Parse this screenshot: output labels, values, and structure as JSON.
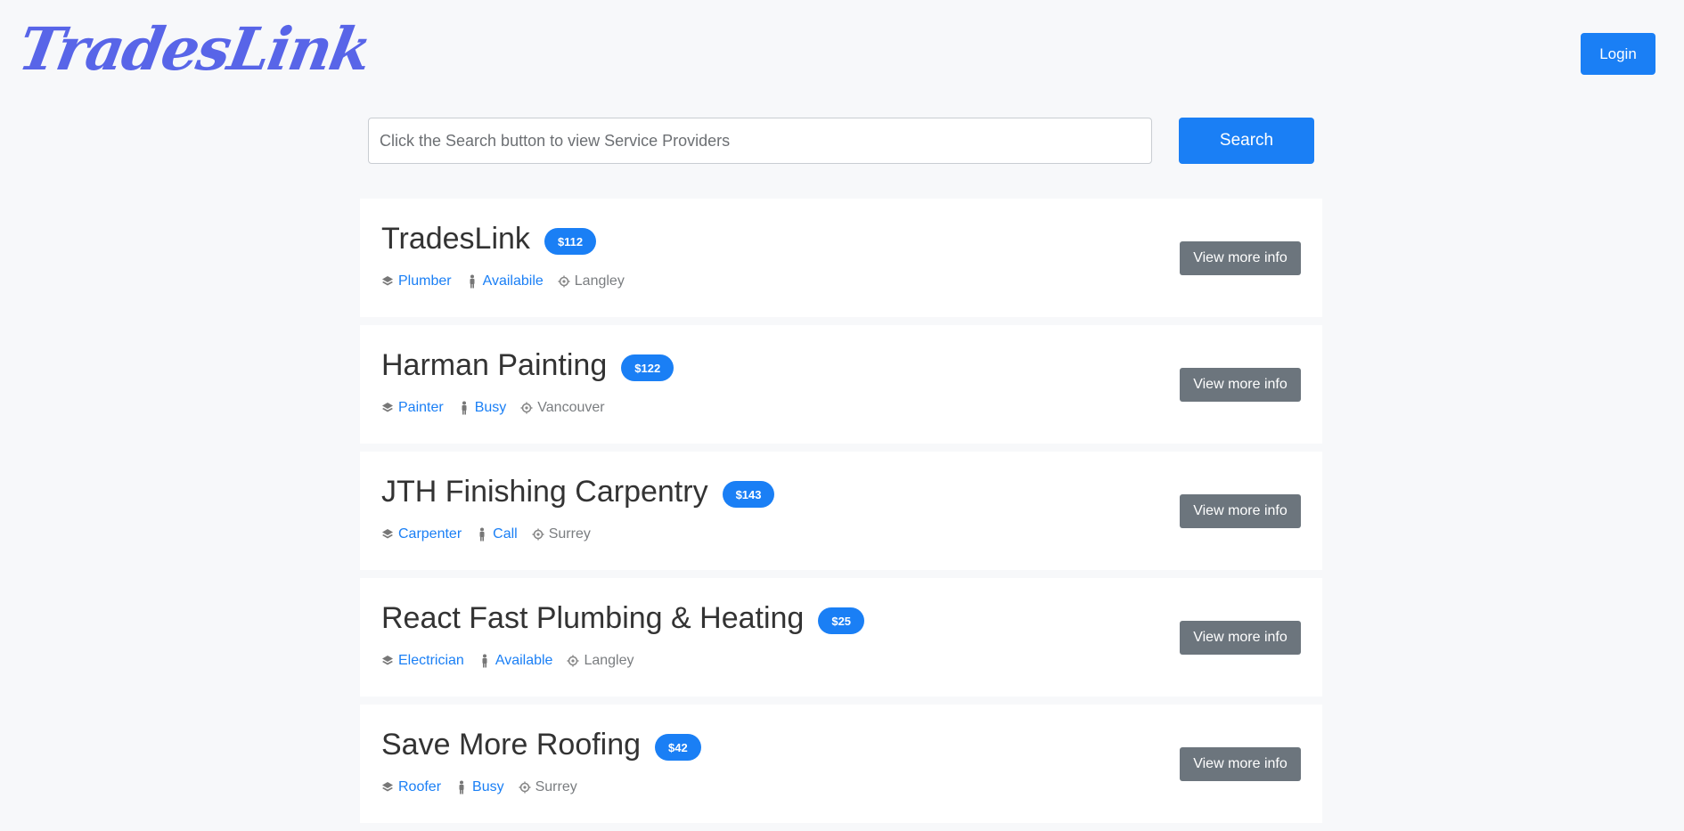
{
  "header": {
    "logo_text": "TradesLink",
    "login_label": "Login"
  },
  "search": {
    "placeholder": "Click the Search button to view Service Providers",
    "value": "",
    "button_label": "Search"
  },
  "providers": [
    {
      "name": "TradesLink",
      "price": "$112",
      "trade": "Plumber",
      "status": "Availabile",
      "location": "Langley",
      "action_label": "View more info"
    },
    {
      "name": "Harman Painting",
      "price": "$122",
      "trade": "Painter",
      "status": "Busy",
      "location": "Vancouver",
      "action_label": "View more info"
    },
    {
      "name": "JTH Finishing Carpentry",
      "price": "$143",
      "trade": "Carpenter",
      "status": "Call",
      "location": "Surrey",
      "action_label": "View more info"
    },
    {
      "name": "React Fast Plumbing & Heating",
      "price": "$25",
      "trade": "Electrician",
      "status": "Available",
      "location": "Langley",
      "action_label": "View more info"
    },
    {
      "name": "Save More Roofing",
      "price": "$42",
      "trade": "Roofer",
      "status": "Busy",
      "location": "Surrey",
      "action_label": "View more info"
    }
  ],
  "icons": {
    "trade": "layers-icon",
    "status": "person-icon",
    "location": "location-target-icon"
  },
  "colors": {
    "accent": "#1a7ff5",
    "logo": "#5865e8",
    "secondary_button": "#6c757d",
    "background": "#f7f8fa"
  }
}
